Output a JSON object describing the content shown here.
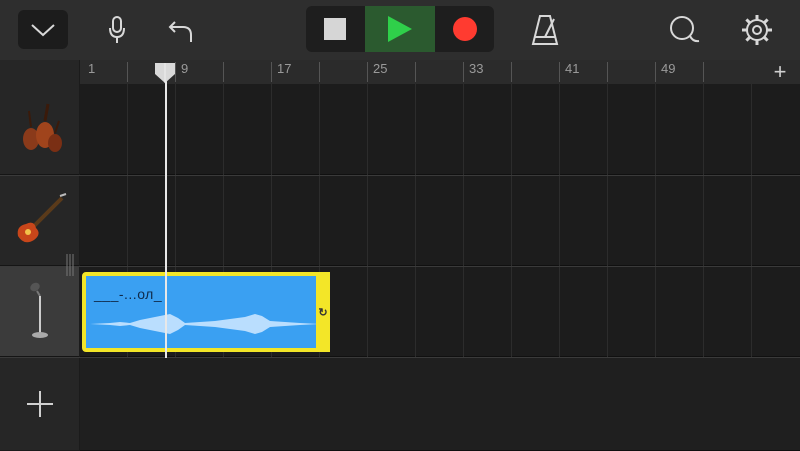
{
  "toolbar": {
    "menu_icon": "chevron-down-icon",
    "mic_icon": "microphone-icon",
    "undo_icon": "undo-icon",
    "metronome_icon": "metronome-icon",
    "loop_browser_icon": "loop-browser-icon",
    "settings_icon": "gear-icon"
  },
  "transport": {
    "stop_icon": "stop-icon",
    "play_icon": "play-icon",
    "record_icon": "record-icon",
    "play_active_color": "#2b5a2f",
    "play_icon_color": "#2fd04a",
    "record_color": "#ff3b30"
  },
  "ruler": {
    "bars": [
      "1",
      "9",
      "17",
      "25",
      "33",
      "41",
      "49"
    ],
    "add_label": "+"
  },
  "tracks": [
    {
      "instrument": "strings",
      "icon": "violin-icon"
    },
    {
      "instrument": "bass",
      "icon": "bass-guitar-icon"
    },
    {
      "instrument": "audio recorder",
      "icon": "microphone-stand-icon",
      "selected": true
    }
  ],
  "region": {
    "name": "___-...ол_",
    "color": "#3aa0f2",
    "border_color": "#f3e628",
    "loop_icon": "loop-icon"
  },
  "add_track_label": "+"
}
